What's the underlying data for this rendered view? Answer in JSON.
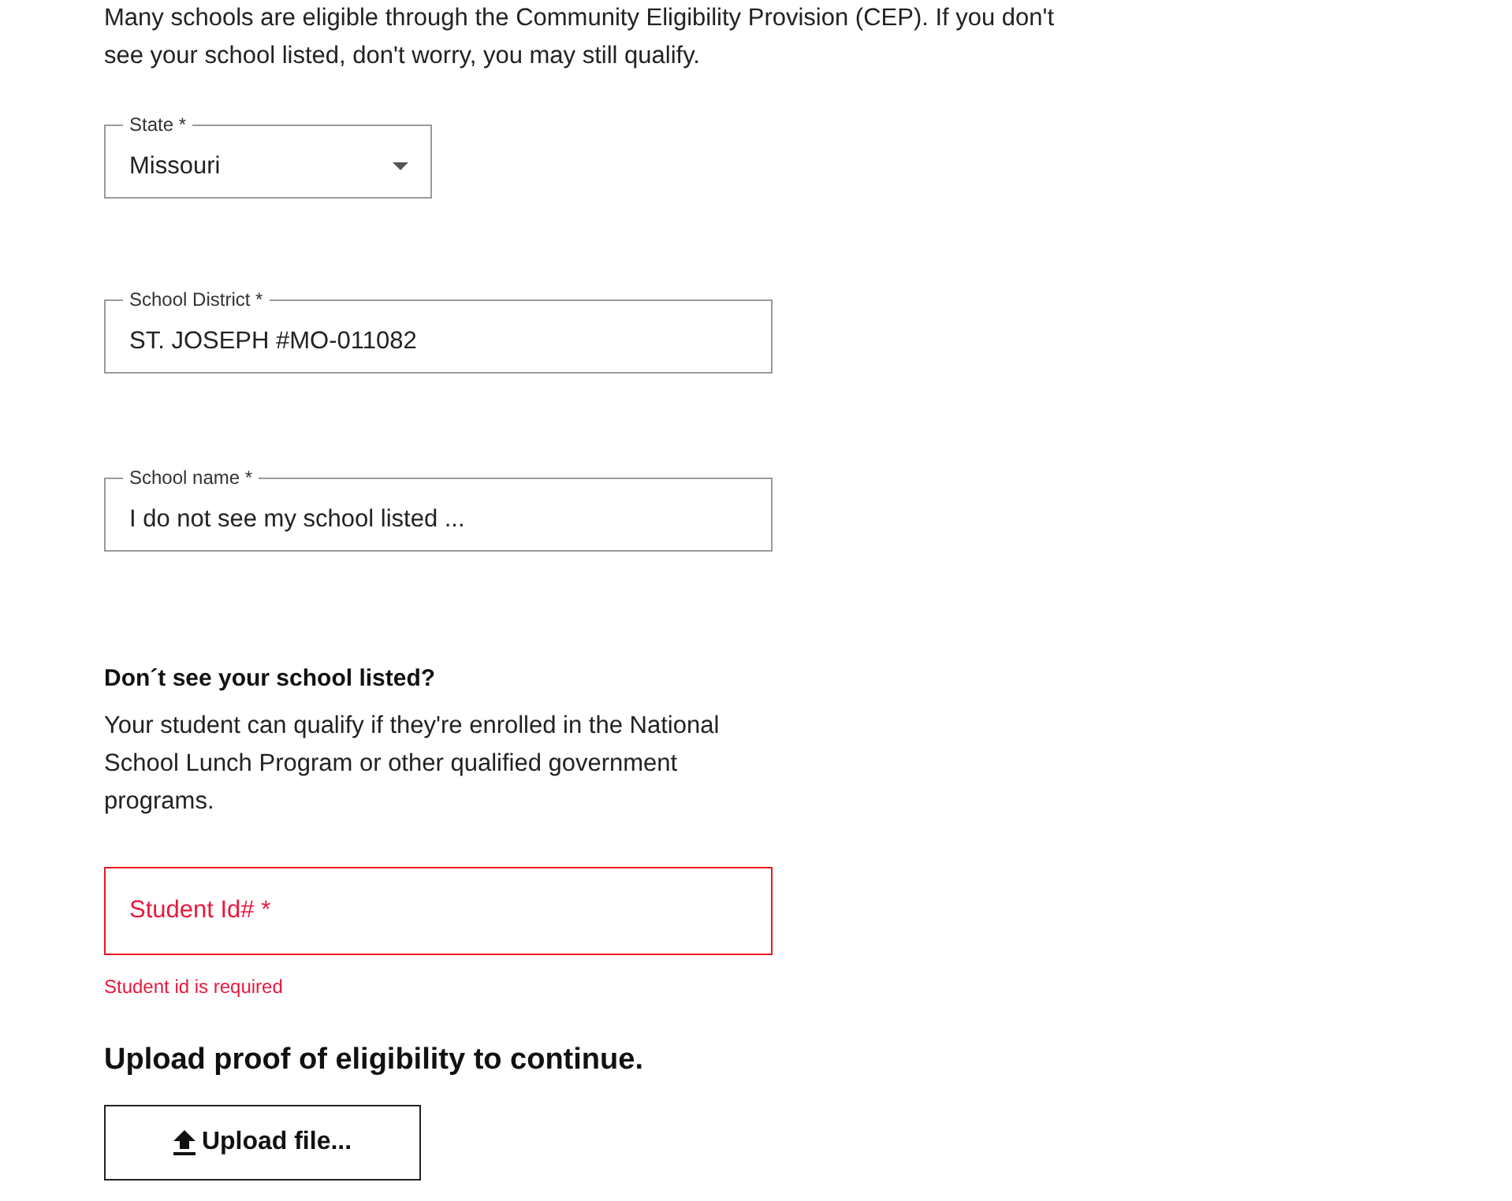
{
  "intro": "Many schools are eligible through the Community Eligibility Provision (CEP). If you don't see your school listed, don't worry, you may still qualify.",
  "fields": [
    {
      "kind": "select",
      "label": "State *",
      "value": "Missouri",
      "error": false
    },
    {
      "kind": "text",
      "label": "School District *",
      "value": "ST. JOSEPH #MO-011082",
      "error": false
    },
    {
      "kind": "text",
      "label": "School name *",
      "value": "I do not see my school listed ...",
      "error": false
    }
  ],
  "notice": {
    "heading": "Don´t see your school listed?",
    "body": "Your student can qualify if they're enrolled in the National School Lunch Program or other qualified government programs."
  },
  "student_id": {
    "placeholder": "Student Id# *",
    "error": true,
    "message": "Student id is required"
  },
  "upload": {
    "heading": "Upload proof of eligibility to continue.",
    "button": "Upload file..."
  }
}
